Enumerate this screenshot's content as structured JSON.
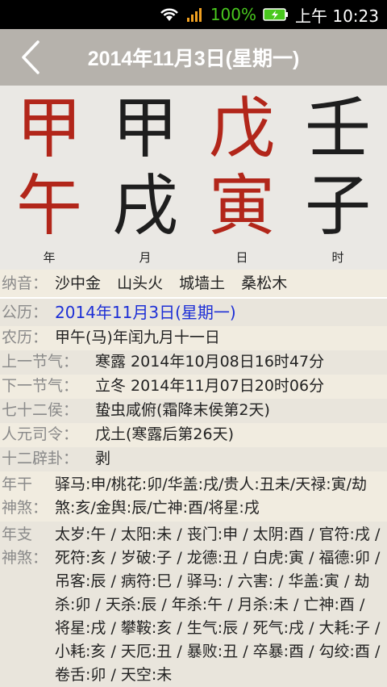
{
  "status_bar": {
    "battery_percent": "100%",
    "time": "上午 10:23"
  },
  "header": {
    "title": "2014年11月3日(星期一)"
  },
  "pillars": [
    {
      "label": "年",
      "stem": "甲",
      "branch": "午",
      "stem_color": "#b2261a",
      "branch_color": "#b2261a"
    },
    {
      "label": "月",
      "stem": "甲",
      "branch": "戌",
      "stem_color": "#1e1e1e",
      "branch_color": "#1e1e1e"
    },
    {
      "label": "日",
      "stem": "戊",
      "branch": "寅",
      "stem_color": "#b2261a",
      "branch_color": "#b2261a"
    },
    {
      "label": "时",
      "stem": "壬",
      "branch": "子",
      "stem_color": "#1e1e1e",
      "branch_color": "#1e1e1e"
    }
  ],
  "rows": {
    "nayin": {
      "label": "纳音：",
      "items": [
        "沙中金",
        "山头火",
        "城墙土",
        "桑松木"
      ]
    },
    "solar": {
      "label": "公历：",
      "value": "2014年11月3日(星期一)"
    },
    "lunar": {
      "label": "农历：",
      "value": "甲午(马)年闰九月十一日"
    },
    "prev_term": {
      "label": "上一节气：",
      "value": "寒露  2014年10月08日16时47分"
    },
    "next_term": {
      "label": "下一节气：",
      "value": "立冬  2014年11月07日20时06分"
    },
    "hou": {
      "label": "七十二侯：",
      "value": "蛰虫咸俯(霜降末侯第2天)"
    },
    "renyuan": {
      "label": "人元司令：",
      "value": "戊土(寒露后第26天)"
    },
    "bigua": {
      "label": "十二辟卦：",
      "value": "剥"
    },
    "year_stem_shensha": {
      "label_line1": "年干",
      "label_line2": "神煞：",
      "value": "驿马:申/桃花:卯/华盖:戌/贵人:丑未/天禄:寅/劫煞:亥/金舆:辰/亡神:酉/将星:戌"
    },
    "year_branch_shensha": {
      "label_line1": "年支",
      "label_line2": "神煞：",
      "value": "太岁:午 / 太阳:未 / 丧门:申 / 太阴:酉 / 官符:戌 / 死符:亥 / 岁破:子 / 龙德:丑 / 白虎:寅 / 福德:卯 / 吊客:辰 / 病符:巳 / 驿马: / 六害: / 华盖:寅 / 劫杀:卯 / 天杀:辰 / 年杀:午 / 月杀:未 / 亡神:酉 / 将星:戌 / 攀鞍:亥 / 生气:辰 / 死气:戌 / 大耗:子 / 小耗:亥 / 天厄:丑 / 暴败:丑 / 卒暴:酉 / 勾绞:酉 / 卷舌:卯 / 天空:未"
    }
  }
}
